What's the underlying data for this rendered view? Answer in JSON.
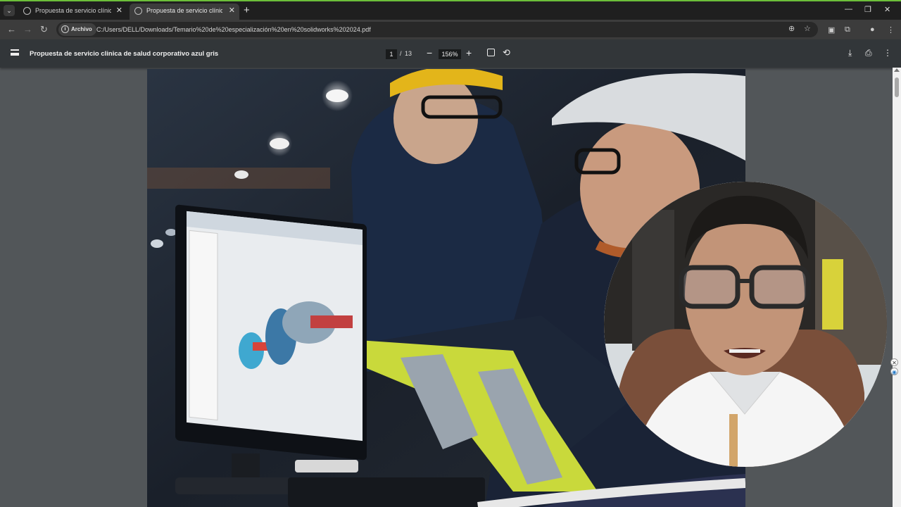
{
  "browser": {
    "tabs": [
      {
        "title": "Propuesta de servicio clínica de",
        "active": false
      },
      {
        "title": "Propuesta de servicio clínica de",
        "active": true
      }
    ],
    "new_tab": "+",
    "window_controls": {
      "minimize": "—",
      "restore": "❐",
      "close": "✕"
    },
    "address": {
      "chip": "Archivo",
      "url": "C:/Users/DELL/Downloads/Temario%20de%20especialización%20en%20solidworks%202024.pdf"
    }
  },
  "pdf_viewer": {
    "title": "Propuesta de servicio clinica de salud corporativo azul gris",
    "page_current": "1",
    "page_separator": "/",
    "page_total": "13",
    "zoom": "156%"
  },
  "colors": {
    "tab_accent": "#6cbf3a",
    "toolbar": "#3c3c3c",
    "pdf_bar": "#323639",
    "viewer_bg": "#525659"
  },
  "icons": [
    "search-icon",
    "star-icon",
    "extensions-icon",
    "profile-icon",
    "download-icon",
    "print-icon",
    "rotate-icon",
    "fit-icon"
  ]
}
